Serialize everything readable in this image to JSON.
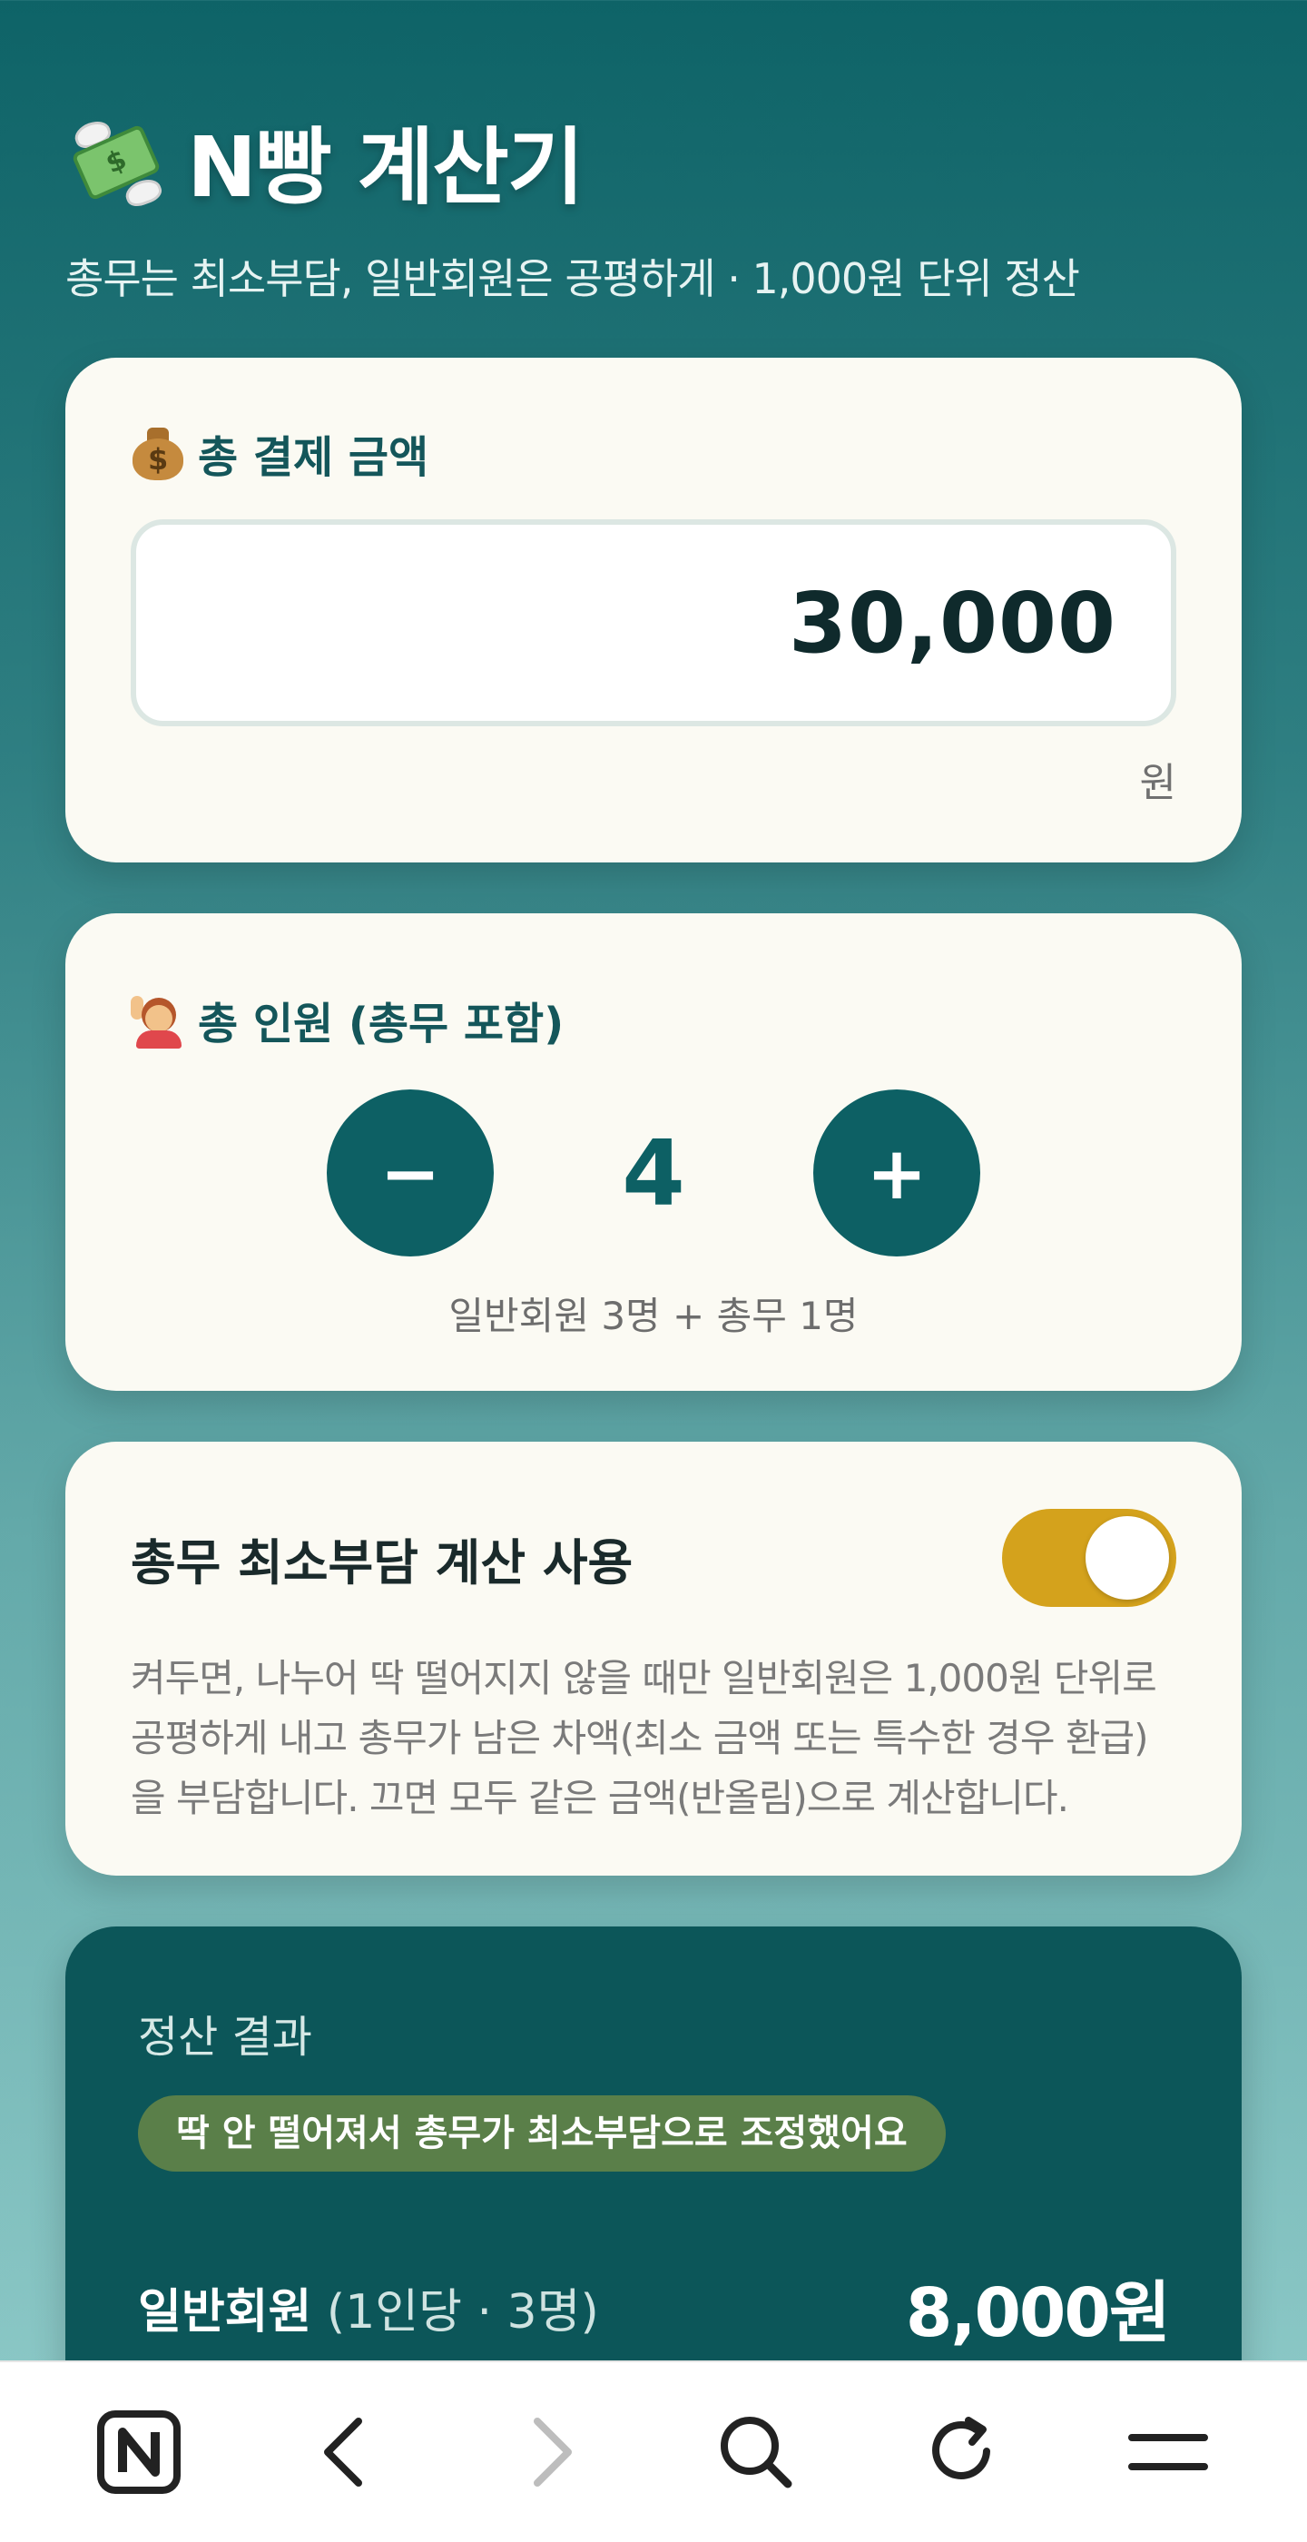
{
  "header": {
    "title": "N빵 계산기",
    "subtitle": "총무는 최소부담, 일반회원은 공평하게 · 1,000원 단위 정산",
    "icon": "money-with-wings-icon"
  },
  "amount_card": {
    "label": "총 결제 금액",
    "icon": "money-bag-icon",
    "value": "30,000",
    "unit": "원"
  },
  "people_card": {
    "label": "총 인원 (총무 포함)",
    "icon": "person-raising-hand-icon",
    "minus_label": "−",
    "plus_label": "+",
    "count": "4",
    "note": "일반회원 3명 + 총무 1명"
  },
  "toggle_card": {
    "title": "총무 최소부담 계산 사용",
    "enabled": true,
    "description": "켜두면, 나누어 딱 떨어지지 않을 때만 일반회원은 1,000원 단위로 공평하게 내고 총무가 남은 차액(최소 금액 또는 특수한 경우 환급)을 부담합니다. 끄면 모두 같은 금액(반올림)으로 계산합니다."
  },
  "result": {
    "label": "정산 결과",
    "badge": "딱 안 떨어져서 총무가 최소부담으로 조정했어요",
    "rows": [
      {
        "name": "일반회원",
        "sub": " (1인당 · 3명)",
        "amount": "8,000원"
      }
    ]
  },
  "browser_nav": {
    "icons": [
      "naver-home-icon",
      "back-arrow-icon",
      "forward-arrow-icon",
      "search-icon",
      "refresh-icon",
      "menu-icon"
    ]
  },
  "colors": {
    "primary": "#0d6064",
    "accent_toggle": "#d4a21c",
    "badge": "#5a7f49",
    "card_bg": "#fbfaf3"
  }
}
